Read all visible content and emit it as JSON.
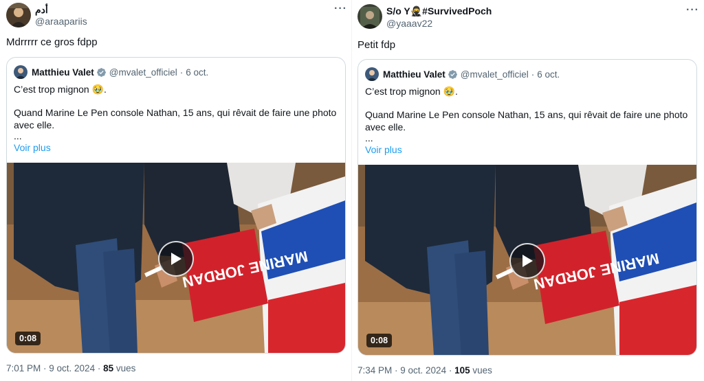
{
  "tweets": [
    {
      "author_name": "أدم",
      "author_handle": "@araapariis",
      "more": "···",
      "text": "Mdrrrrr ce gros fdpp",
      "quote": {
        "name": "Matthieu Valet",
        "handle": "@mvalet_officiel",
        "dot": "·",
        "date": "6 oct.",
        "line1": "C’est trop mignon 🥹.",
        "line2": "Quand Marine Le Pen console Nathan, 15 ans, qui rêvait de faire une photo avec elle.",
        "ellipsis": "...",
        "voir_plus": "Voir plus",
        "duration": "0:08"
      },
      "time_date": "7:01 PM · 9 oct. 2024 · ",
      "views_count": "85",
      "views_label": " vues"
    },
    {
      "author_name": "S/o Y🥷#SurvivedPoch",
      "author_handle": "@yaaav22",
      "more": "···",
      "text": "Petit fdp",
      "quote": {
        "name": "Matthieu Valet",
        "handle": "@mvalet_officiel",
        "dot": "·",
        "date": "6 oct.",
        "line1": "C’est trop mignon 🥹.",
        "line2": "Quand Marine Le Pen console Nathan, 15 ans, qui rêvait de faire une photo avec elle.",
        "ellipsis": "...",
        "voir_plus": "Voir plus",
        "duration": "0:08"
      },
      "time_date": "7:34 PM · 9 oct. 2024 · ",
      "views_count": "105",
      "views_label": " vues"
    }
  ],
  "media_placard_text": "MARINE JORDAN",
  "colors": {
    "link": "#1d9bf0",
    "secondary_text": "#536471",
    "border": "#cfd9de",
    "verified": "#829aab"
  }
}
